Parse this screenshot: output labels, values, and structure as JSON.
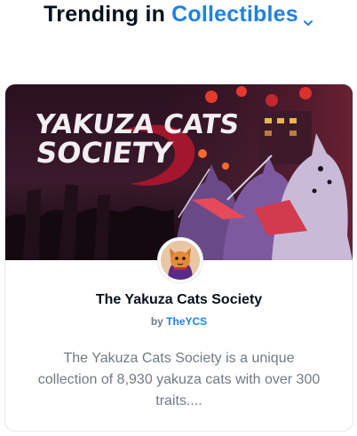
{
  "section": {
    "prefix": "Trending in",
    "category": "Collectibles",
    "dropdown_icon": "chevron-down-icon"
  },
  "card": {
    "banner_text_line1": "YAKUZA CATS",
    "banner_text_line2": "SOCIETY",
    "title": "The Yakuza Cats Society",
    "by_label": "by",
    "creator": "TheYCS",
    "description": "The Yakuza Cats Society is a unique collection of 8,930 yakuza cats with over 300 traits....",
    "colors": {
      "accent": "#2081e2",
      "banner_red": "#c8283a",
      "banner_dark": "#1a0d1d"
    }
  }
}
